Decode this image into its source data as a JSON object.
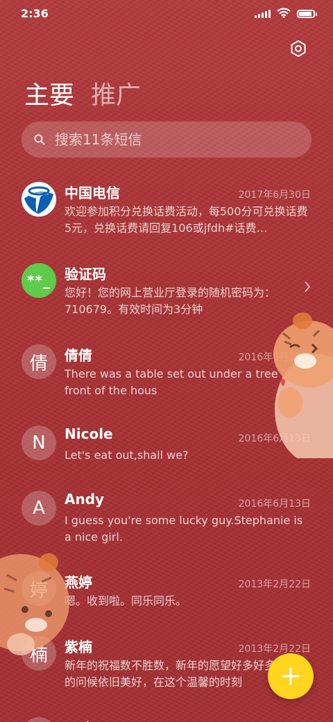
{
  "status_bar": {
    "time": "2:36"
  },
  "tabs": {
    "main": "主要",
    "promo": "推广"
  },
  "search": {
    "placeholder": "搜索11条短信"
  },
  "messages": [
    {
      "name": "中国电信",
      "date": "2017年6月30日",
      "preview": "欢迎参加积分兑换话费活动，每500分可兑换话费5元，兑换话费请回复106或jfdh#话费…",
      "avatar": "china-telecom-logo"
    },
    {
      "name": "验证码",
      "date": "",
      "preview": "您好！您的网上营业厅登录的随机密码为：710679。有效时间为3分钟",
      "avatar_text": "**_"
    },
    {
      "name": "倩倩",
      "date": "2016年6月13日",
      "preview": "There was a table set out under a tree in front of the hous",
      "avatar_text": "倩"
    },
    {
      "name": "Nicole",
      "date": "2016年6月13日",
      "preview": "Let's eat out,shall we?",
      "avatar_text": "N"
    },
    {
      "name": "Andy",
      "date": "2016年6月13日",
      "preview": "I guess you're some lucky guy.Stephanie is a nice girl.",
      "avatar_text": "A"
    },
    {
      "name": "燕婷",
      "date": "2013年2月22日",
      "preview": "嗯。收到啦。同乐同乐。",
      "avatar_text": "婷"
    },
    {
      "name": "紫楠",
      "date": "2013年2月22日",
      "preview": "新年的祝福数不胜数，新年的愿望好多好多，新年的问候依旧美好，在这个温馨的时刻",
      "avatar_text": "楠"
    },
    {
      "name": "子玲",
      "date": "",
      "preview": "",
      "avatar_text": ""
    }
  ],
  "colors": {
    "background": "#a93235",
    "fab": "#ffd51f",
    "verification_avatar": "#5ecb4a",
    "telecom_blue": "#0b5fb4"
  },
  "icons": [
    "settings-icon",
    "search-icon",
    "chevron-right-icon",
    "plus-icon"
  ]
}
